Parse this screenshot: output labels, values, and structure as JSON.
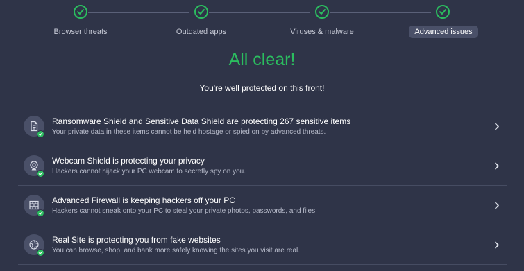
{
  "stepper": {
    "steps": [
      {
        "label": "Browser threats",
        "status": "complete"
      },
      {
        "label": "Outdated apps",
        "status": "complete"
      },
      {
        "label": "Viruses & malware",
        "status": "complete"
      },
      {
        "label": "Advanced issues",
        "status": "complete",
        "active": true
      }
    ]
  },
  "main": {
    "title": "All clear!",
    "subtitle": "You're well protected on this front!"
  },
  "items": [
    {
      "icon": "document-lock-icon",
      "title": "Ransomware Shield and Sensitive Data Shield are protecting 267 sensitive items",
      "description": "Your private data in these items cannot be held hostage or spied on by advanced threats."
    },
    {
      "icon": "webcam-icon",
      "title": "Webcam Shield is protecting your privacy",
      "description": "Hackers cannot hijack your PC webcam to secretly spy on you."
    },
    {
      "icon": "firewall-icon",
      "title": "Advanced Firewall is keeping hackers off your PC",
      "description": "Hackers cannot sneak onto your PC to steal your private photos, passwords, and files."
    },
    {
      "icon": "globe-icon",
      "title": "Real Site is protecting you from fake websites",
      "description": "You can browse, shop, and bank more safely knowing the sites you visit are real."
    }
  ],
  "colors": {
    "background": "#2f3448",
    "accent_green": "#2bbd5f",
    "divider": "#464c62",
    "active_tab": "#4a5068"
  }
}
